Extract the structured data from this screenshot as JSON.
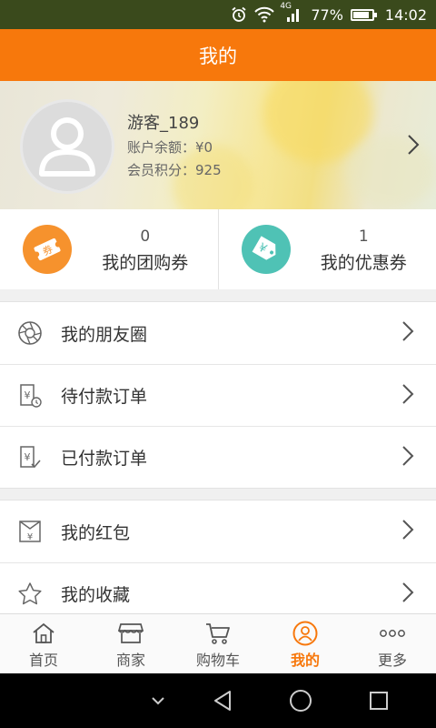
{
  "status_bar": {
    "network_label": "4G",
    "battery_text": "77%",
    "battery_level": 0.77,
    "time": "14:02",
    "icons": [
      "alarm-icon",
      "wifi-icon",
      "signal-icon",
      "battery-icon"
    ]
  },
  "header": {
    "title": "我的"
  },
  "profile": {
    "username": "游客_189",
    "balance": "账户余额：¥0",
    "points": "会员积分：925"
  },
  "coupons": [
    {
      "count": "0",
      "label": "我的团购券",
      "icon": "group-coupon-icon",
      "icon_text": "券",
      "color": "#f6922d"
    },
    {
      "count": "1",
      "label": "我的优惠券",
      "icon": "discount-coupon-icon",
      "icon_text": "¥",
      "color": "#4fc2b5"
    }
  ],
  "menu_group_1": [
    {
      "label": "我的朋友圈",
      "icon": "aperture-icon"
    },
    {
      "label": "待付款订单",
      "icon": "pending-payment-icon"
    },
    {
      "label": "已付款订单",
      "icon": "paid-order-icon"
    }
  ],
  "menu_group_2": [
    {
      "label": "我的红包",
      "icon": "red-envelope-icon"
    },
    {
      "label": "我的收藏",
      "icon": "star-icon"
    }
  ],
  "tabbar": [
    {
      "label": "首页",
      "icon": "home-icon",
      "active": false
    },
    {
      "label": "商家",
      "icon": "store-icon",
      "active": false
    },
    {
      "label": "购物车",
      "icon": "cart-icon",
      "active": false
    },
    {
      "label": "我的",
      "icon": "user-icon",
      "active": true
    },
    {
      "label": "更多",
      "icon": "more-icon",
      "active": false
    }
  ],
  "colors": {
    "accent": "#f7780c",
    "status_bar": "#3a4a1c",
    "icon_gray": "#666666"
  }
}
